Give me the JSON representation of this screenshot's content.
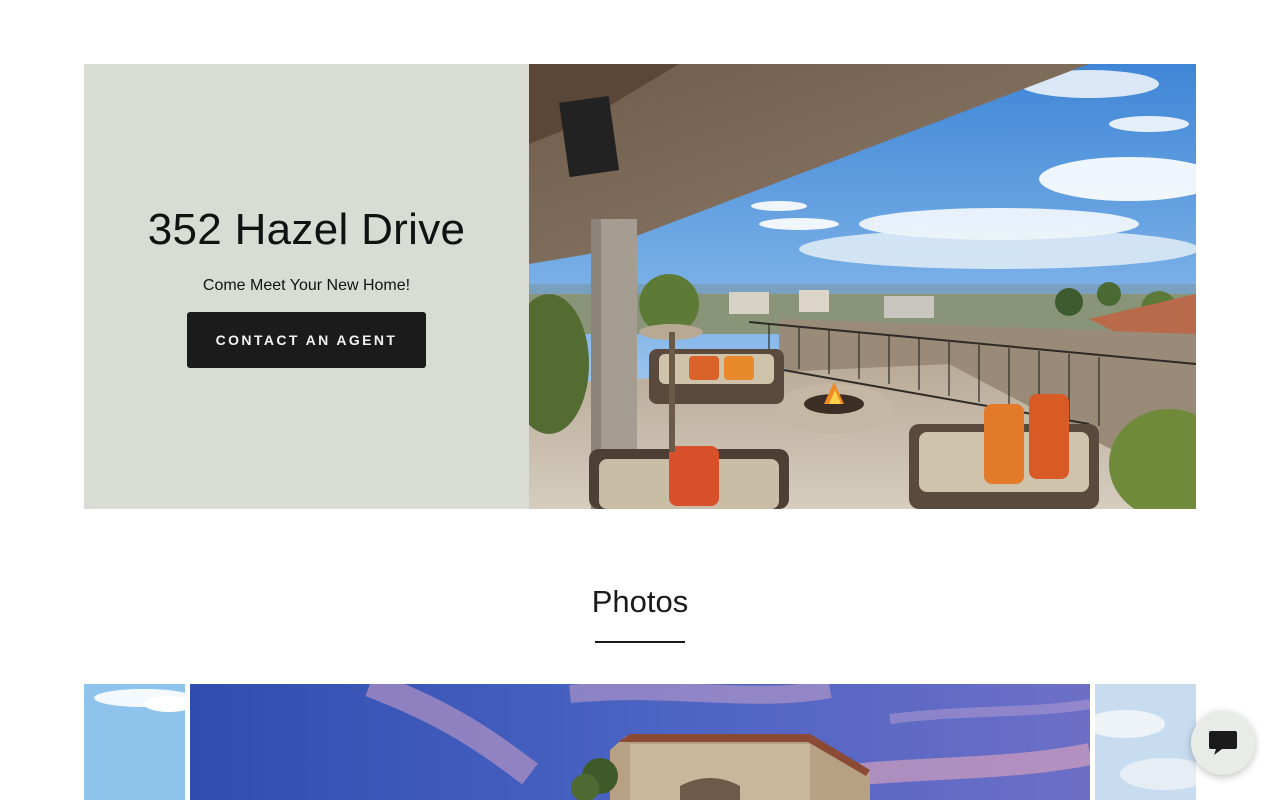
{
  "hero": {
    "title": "352 Hazel Drive",
    "subtitle": "Come Meet Your New Home!",
    "cta_label": "CONTACT AN AGENT",
    "panel_color": "#d9dcd5"
  },
  "photos": {
    "title": "Photos"
  },
  "chat": {
    "icon": "chat-bubble-icon"
  },
  "colors": {
    "button_bg": "#1b1b1b",
    "text": "#111111"
  }
}
